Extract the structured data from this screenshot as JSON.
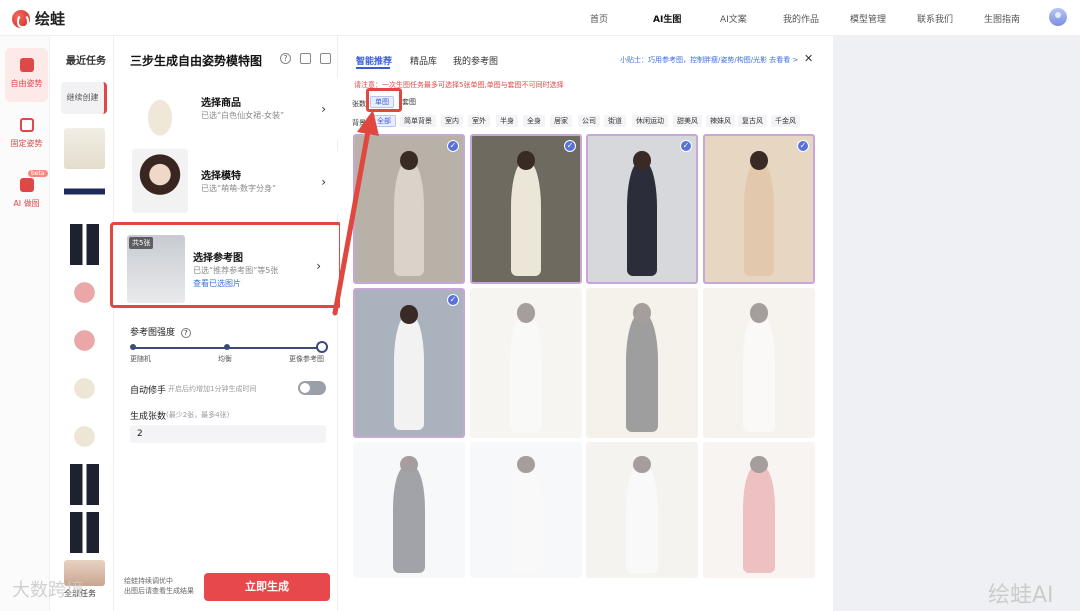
{
  "header": {
    "logo_text": "绘蛙",
    "nav": [
      {
        "label": "首页",
        "active": false
      },
      {
        "label": "AI生图",
        "active": true
      },
      {
        "label": "AI文案",
        "active": false
      },
      {
        "label": "我的作品",
        "active": false
      },
      {
        "label": "模型管理",
        "active": false
      },
      {
        "label": "联系我们",
        "active": false
      },
      {
        "label": "生图指南",
        "active": false
      }
    ]
  },
  "rail": {
    "items": [
      {
        "label": "自由姿势",
        "icon": "person-pose-icon",
        "active": true
      },
      {
        "label": "固定姿势",
        "icon": "person-fixed-icon",
        "active": false
      },
      {
        "label": "AI 做图",
        "icon": "image-icon",
        "active": false,
        "badge": "beta"
      }
    ]
  },
  "recent": {
    "title": "最近任务",
    "continue_label": "继续创建",
    "footer_label": "全部任务"
  },
  "steps": {
    "title": "三步生成自由姿势模特图",
    "cards": [
      {
        "name": "选择商品",
        "desc": "已选“白色仙女裙-女装”"
      },
      {
        "name": "选择模特",
        "desc": "已选“萌萌-数字分身”"
      },
      {
        "name": "选择参考图",
        "desc": "已选“推荐参考图”等5张",
        "link": "查看已选图片",
        "badge": "共5张"
      }
    ],
    "strength_label": "参考图强度",
    "strength_ticks": [
      "更随机",
      "均衡",
      "更像参考图"
    ],
    "strength_value": 1.0,
    "autofix_label": "自动修手",
    "autofix_hint": "开启后约增加1分钟生成时间",
    "autofix_on": false,
    "count_label": "生成张数",
    "count_hint": "(最少2张，最多4张)",
    "count_value": "2",
    "footer_status_line1": "绘蛙持续调优中",
    "footer_status_line2": "出图后请查看生成结果",
    "generate_label": "立即生成"
  },
  "gallery": {
    "tabs": [
      {
        "label": "智能推荐",
        "active": true
      },
      {
        "label": "精品库",
        "active": false
      },
      {
        "label": "我的参考图",
        "active": false
      }
    ],
    "tip": "小贴士：巧用参考图，控制胖瘦/姿势/构图/光影 去看看 >",
    "warning": "请注意：一次生图任务最多可选择5张单图,单图与套图不可同时选择",
    "count_row_label": "张数",
    "count_chips": [
      {
        "label": "单图",
        "selected": true
      },
      {
        "label": "套图",
        "selected": false
      }
    ],
    "bg_row_label": "背景",
    "bg_chips": [
      {
        "label": "全部",
        "selected": true
      },
      {
        "label": "简单背景",
        "selected": false
      },
      {
        "label": "室内",
        "selected": false
      },
      {
        "label": "室外",
        "selected": false
      },
      {
        "label": "半身",
        "selected": false
      },
      {
        "label": "全身",
        "selected": false
      },
      {
        "label": "居家",
        "selected": false
      },
      {
        "label": "公司",
        "selected": false
      },
      {
        "label": "街道",
        "selected": false
      },
      {
        "label": "休闲运动",
        "selected": false
      },
      {
        "label": "甜美风",
        "selected": false
      },
      {
        "label": "辣妹风",
        "selected": false
      },
      {
        "label": "复古风",
        "selected": false
      },
      {
        "label": "千金风",
        "selected": false
      }
    ],
    "tiles": [
      {
        "selected": true,
        "bg": "#b7b1a7",
        "dress": "#d9d3c9"
      },
      {
        "selected": true,
        "bg": "#6f6a60",
        "dress": "#ece6d8"
      },
      {
        "selected": true,
        "bg": "#d7d8dc",
        "dress": "#2b2e3a"
      },
      {
        "selected": true,
        "bg": "#e7d6c2",
        "dress": "#e2c8ad"
      },
      {
        "selected": true,
        "bg": "#aab3bd",
        "dress": "#f2f2f2"
      },
      {
        "selected": false,
        "bg": "#ece9e2",
        "dress": "#f2f2ef"
      },
      {
        "selected": false,
        "bg": "#e8e3d5",
        "dress": "#2a2a2a"
      },
      {
        "selected": false,
        "bg": "#ece6dc",
        "dress": "#f5f2ee"
      },
      {
        "selected": false,
        "bg": "#eef0f2",
        "dress": "#30363f"
      },
      {
        "selected": false,
        "bg": "#eef0f2",
        "dress": "#f3f3f3"
      },
      {
        "selected": false,
        "bg": "#ebe6df",
        "dress": "#f2f2f2"
      },
      {
        "selected": false,
        "bg": "#efe7e3",
        "dress": "#d8747a"
      }
    ]
  },
  "watermarks": [
    "绘蛙AI",
    "大数跨境"
  ],
  "colors": {
    "accent": "#e6484c",
    "selection": "#3b5bd6",
    "highlight": "#e0473f"
  }
}
